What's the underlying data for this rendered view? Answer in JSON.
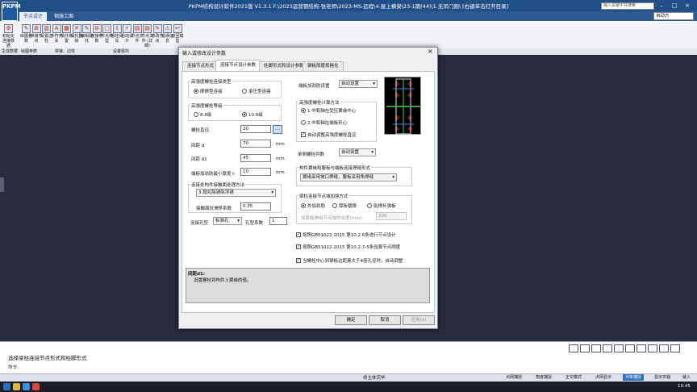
{
  "app": {
    "logo": "PKPM",
    "title": "PKPM结构设计软件2021版 V1.3.1 F:\\2023运营钢结构-张老师\\2023-MS-远程\\4.屋上横梁\\23-1期(44)\\1.无吊门刚\\ [右键单击打开目录]",
    "search_placeholder": "输入关键字并搜索",
    "mode": "自动方",
    "window_controls": [
      "–",
      "□",
      "×"
    ]
  },
  "tabs": [
    {
      "label": "节点设计",
      "active": true
    },
    {
      "label": "钢施工图",
      "active": false
    }
  ],
  "ribbon": {
    "buttons": [
      {
        "label": "初始化 连接数据",
        "icon": "init-icon"
      },
      {
        "label": "绘图参数",
        "icon": "draw-params-icon"
      },
      {
        "label": "拼接节点",
        "icon": "splice-icon"
      },
      {
        "label": "设置边柱",
        "icon": "edge-column-icon"
      },
      {
        "label": "字符开关",
        "icon": "char-toggle-icon"
      },
      {
        "label": "檩托布置",
        "icon": "purlin-place-icon"
      },
      {
        "label": "檩托删除",
        "icon": "purlin-delete-icon"
      },
      {
        "label": "编辑檩托",
        "icon": "purlin-edit-icon"
      },
      {
        "label": "连接参数",
        "icon": "conn-params-icon"
      },
      {
        "label": "节点类型",
        "icon": "node-type-icon"
      },
      {
        "label": "悬挂吊车",
        "icon": "crane-icon"
      },
      {
        "label": "自动设计",
        "icon": "auto-design-icon"
      },
      {
        "label": "节点文件",
        "icon": "node-file-icon"
      },
      {
        "label": "节点文件 (详细)",
        "icon": "node-file-detail-icon"
      },
      {
        "label": "修改节点",
        "icon": "edit-node-icon"
      },
      {
        "label": "错误信息",
        "icon": "error-icon"
      },
      {
        "label": "返回模型",
        "icon": "return-icon"
      }
    ],
    "groups": [
      "生成数据",
      "绘图参数",
      "拼接、边柱",
      "设置檩托"
    ]
  },
  "dialog": {
    "title": "输入或修改设计参数",
    "close": "×",
    "tabs": [
      {
        "label": "连接节点形式",
        "active": false
      },
      {
        "label": "连接节点设计参数",
        "active": true
      },
      {
        "label": "柱脚形式和设计参数",
        "active": false
      },
      {
        "label": "钢板厚度规格化",
        "active": false
      }
    ],
    "bolt_type": {
      "title": "高强度螺栓连接类型",
      "options": [
        "摩擦型连接",
        "承压型连接"
      ],
      "selected": 0
    },
    "bolt_grade": {
      "title": "高强度螺栓等级",
      "options": [
        "8.8级",
        "10.9级"
      ],
      "selected": 1
    },
    "fields": {
      "bolt_dia": {
        "label": "螺栓直径",
        "value": "20",
        "button": "..."
      },
      "spacing_d": {
        "label": "间距 d",
        "value": "70",
        "unit": "mm"
      },
      "spacing_d1": {
        "label": "间距 d1",
        "value": "45",
        "unit": "mm"
      },
      "stiff_min": {
        "label": "端板加劲肋最小厚度 t",
        "value": "10",
        "unit": "mm"
      }
    },
    "surface": {
      "title": "连接处构件接触面处理方法",
      "method": "3.抛丸除锈除浮锈",
      "coef_label": "接触面抗滑移系数",
      "coef_value": "0.35"
    },
    "hole": {
      "label": "连接孔型",
      "value": "标准孔",
      "coef_label": "孔型系数",
      "coef_value": "1"
    },
    "right": {
      "stiffener_label": "端板加劲肋设置",
      "stiffener_value": "自动设置",
      "calc_title": "高强度螺栓计算方法",
      "calc_options": [
        "1.中和轴在受压翼缘中心",
        "2.中和轴在端板形心"
      ],
      "calc_selected": 0,
      "auto_adjust": "自动调整高强度螺栓直径",
      "auto_adjust_checked": true,
      "rows_label": "单侧螺栓列数",
      "rows_value": "自动设置",
      "weld_title": "构件翼缘和腹板与端板连接焊缝形式",
      "weld_value": "翼缘采用坡口焊缝，腹板采用角焊缝",
      "beam_title": "梁柱连接节点域加强方式",
      "beam_options": [
        "外加劲肋",
        "厚板替换",
        "贴焊补强板"
      ],
      "beam_selected": 0,
      "plate_label": "加厚板伸出节点域的长度(mm):",
      "plate_value": "200"
    },
    "checks": [
      {
        "label": "按照GB51022-2015 第10.2.6条进行节点设计",
        "checked": true
      },
      {
        "label": "按照GB51022-2015 第10.2.7-5条验算节点刚度",
        "checked": true
      },
      {
        "label": "当螺栓中心到钢板边距离大于4倍孔径时，自动调整",
        "checked": true
      }
    ],
    "help": {
      "title": "间距d1:",
      "text": "设置螺栓到构件上翼缘的值。"
    },
    "buttons": {
      "ok": "确定",
      "cancel": "取消",
      "apply": "应用(A)"
    }
  },
  "command": {
    "text": "选择梁柱连接节点形式和柱脚形式",
    "label": "命令:"
  },
  "status": {
    "text": "修主体完毕",
    "buttons": [
      {
        "label": "点网捕捉",
        "on": false
      },
      {
        "label": "角度捕捉",
        "on": false
      },
      {
        "label": "正交模式",
        "on": false
      },
      {
        "label": "点网显示",
        "on": false
      },
      {
        "label": "对象捕捉",
        "on": true
      },
      {
        "label": "显示叉轴",
        "on": false
      },
      {
        "label": "装入",
        "on": false
      }
    ]
  },
  "clock": "10:45"
}
